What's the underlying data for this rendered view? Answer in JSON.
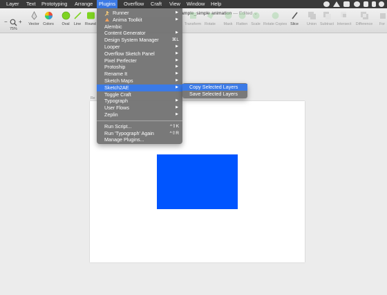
{
  "menubar": {
    "items": [
      {
        "label": "Layer"
      },
      {
        "label": "Text"
      },
      {
        "label": "Prototyping"
      },
      {
        "label": "Arrange"
      },
      {
        "label": "Plugins"
      },
      {
        "label": "Overflow"
      },
      {
        "label": "Craft"
      },
      {
        "label": "View"
      },
      {
        "label": "Window"
      },
      {
        "label": "Help"
      }
    ],
    "active_item": "Plugins",
    "status_icons": [
      "craft-status-icon",
      "wifi-icon",
      "airplay-icon",
      "message-icon",
      "dropbox-icon",
      "battery-icon",
      "sync-icon"
    ]
  },
  "window": {
    "title": "ample_simple animation",
    "edited": "— Edited",
    "title_chevron": "⌄"
  },
  "toolbar": {
    "zoom_minus": "−",
    "zoom_plus": "+",
    "zoom_value": "75%",
    "left_tools": [
      {
        "label": "Vector",
        "icon": "vector-pen-icon"
      },
      {
        "label": "Colors",
        "icon": "color-wheel-icon"
      },
      {
        "label": "Oval",
        "icon": "oval-icon"
      },
      {
        "label": "Line",
        "icon": "line-icon"
      },
      {
        "label": "Round",
        "icon": "rounded-rect-icon"
      }
    ],
    "right_tools": [
      {
        "label": "Transform",
        "icon": "transform-icon"
      },
      {
        "label": "Rotate",
        "icon": "rotate-icon"
      },
      {
        "label": "Mask",
        "icon": "mask-icon"
      },
      {
        "label": "Flatten",
        "icon": "flatten-icon"
      },
      {
        "label": "Scale",
        "icon": "scale-icon"
      },
      {
        "label": "Rotate Copies",
        "icon": "rotate-copies-icon"
      },
      {
        "label": "Slice",
        "icon": "slice-icon"
      },
      {
        "label": "Union",
        "icon": "union-icon"
      },
      {
        "label": "Subtract",
        "icon": "subtract-icon"
      },
      {
        "label": "Intersect",
        "icon": "intersect-icon"
      },
      {
        "label": "Difference",
        "icon": "difference-icon"
      },
      {
        "label": "For",
        "icon": "forward-icon"
      }
    ]
  },
  "plugins_menu": {
    "items": [
      {
        "label": "Runner",
        "icon": "runner-icon",
        "submenu": true
      },
      {
        "label": "Anima Toolkit",
        "icon": "anima-icon",
        "submenu": true
      },
      {
        "label": "Alembic",
        "submenu": false
      },
      {
        "label": "Content Generator",
        "submenu": true
      },
      {
        "label": "Design System Manager",
        "shortcut": "⌘L"
      },
      {
        "label": "Looper",
        "submenu": true
      },
      {
        "label": "Overflow Sketch Panel",
        "submenu": true
      },
      {
        "label": "Pixel Perfecter",
        "submenu": true
      },
      {
        "label": "Protoship",
        "submenu": true
      },
      {
        "label": "Rename It",
        "submenu": true
      },
      {
        "label": "Sketch Maps",
        "submenu": true
      },
      {
        "label": "Sketch2AE",
        "submenu": true,
        "selected": true
      },
      {
        "label": "Toggle Craft",
        "submenu": false
      },
      {
        "label": "Typograph",
        "submenu": true
      },
      {
        "label": "User Flows",
        "submenu": true
      },
      {
        "label": "Zeplin",
        "submenu": true
      }
    ],
    "footer_items": [
      {
        "label": "Run Script...",
        "shortcut": "^⇧K"
      },
      {
        "label": "Run 'Typograph' Again",
        "shortcut": "^⇧R"
      },
      {
        "label": "Manage Plugins..."
      }
    ],
    "submenu_arrow": "▶"
  },
  "sketch2ae_submenu": {
    "items": [
      {
        "label": "Copy Selected Layers",
        "selected": true
      },
      {
        "label": "Save Selected Layers"
      }
    ]
  },
  "canvas": {
    "artboard_label": "Re",
    "background": "#ececec",
    "artboard_color": "#ffffff",
    "rectangle_color": "#0055ff"
  },
  "colors": {
    "menubar": "#3a3a3a",
    "menu_background": "#747474",
    "selection": "#3b7ae6"
  }
}
